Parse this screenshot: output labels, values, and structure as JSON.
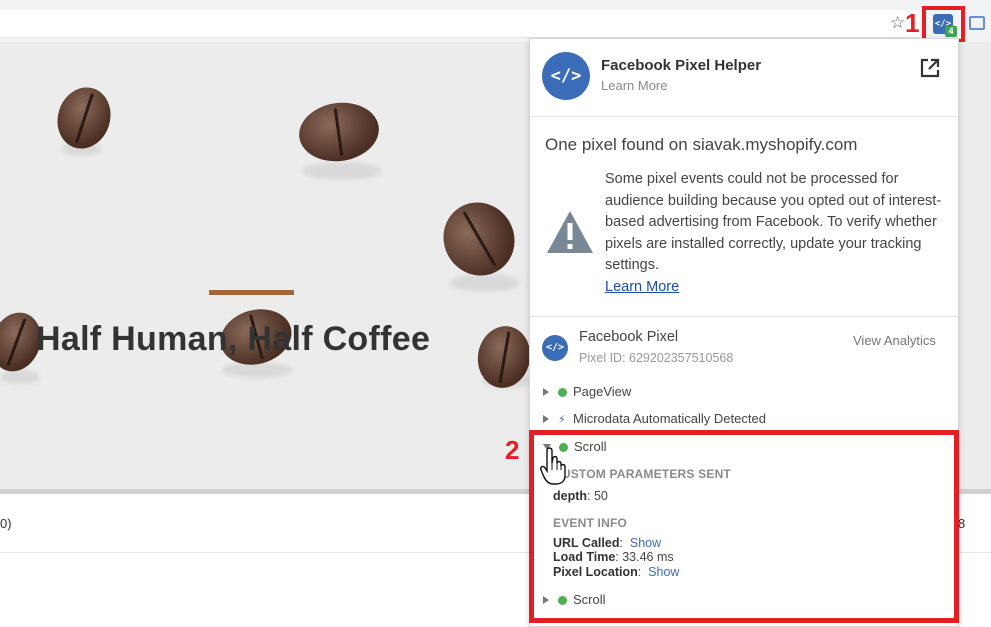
{
  "browser": {
    "extension_badge": "4",
    "callout_1": "1",
    "callout_2": "2"
  },
  "hero": {
    "title": "Half Human, Half Coffee",
    "accent_color": "#a0683a"
  },
  "below": {
    "left_fragment": "0)",
    "right_fragment": "8"
  },
  "popup": {
    "app_title": "Facebook Pixel Helper",
    "app_link": "Learn More",
    "found_text": "One pixel found on siavak.myshopify.com",
    "warning_text": "Some pixel events could not be processed for audience building because you opted out of interest-based advertising from Facebook. To verify whether pixels are installed correctly, update your tracking settings.",
    "warning_link": "Learn More",
    "pixel": {
      "name": "Facebook Pixel",
      "id_label": "Pixel ID: 629202357510568",
      "analytics_link": "View Analytics"
    },
    "events": [
      {
        "name": "PageView",
        "status": "ok",
        "expanded": false
      },
      {
        "name": "Microdata Automatically Detected",
        "status": "info",
        "expanded": false
      },
      {
        "name": "Scroll",
        "status": "ok",
        "expanded": true
      },
      {
        "name": "Scroll",
        "status": "ok",
        "expanded": false
      }
    ],
    "custom_params": {
      "heading": "CUSTOM PARAMETERS SENT",
      "key": "depth",
      "value": ": 50"
    },
    "event_info": {
      "heading": "EVENT INFO",
      "url_label": "URL Called",
      "url_value": "Show",
      "load_label": "Load Time",
      "load_value": ": 33.46 ms",
      "location_label": "Pixel Location",
      "location_value": "Show"
    }
  },
  "colors": {
    "brand_blue": "#3b6cb7",
    "highlight_red": "#e31e24",
    "ok_green": "#4caf50"
  }
}
